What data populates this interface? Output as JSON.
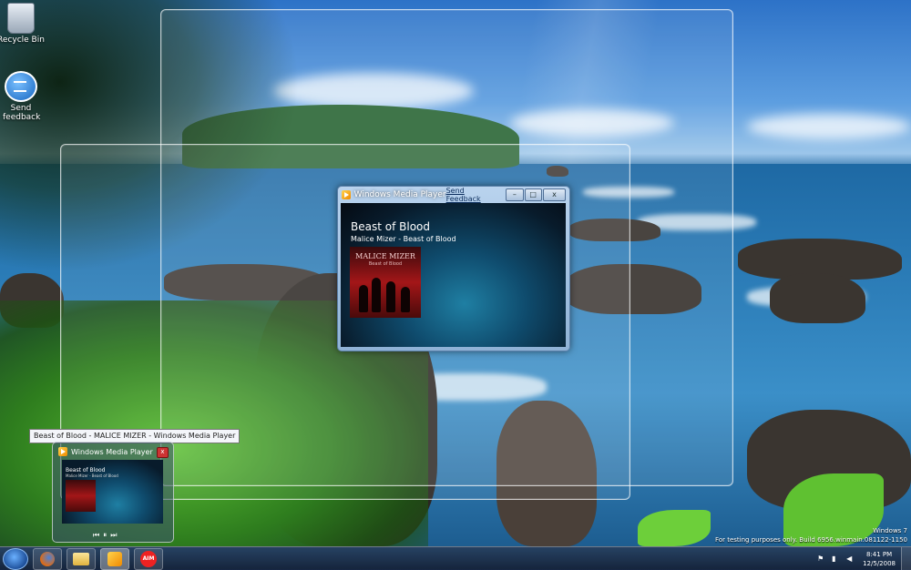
{
  "desktop": {
    "icons": [
      {
        "label": "Recycle Bin",
        "icon": "recycle-bin-icon"
      },
      {
        "label": "Send feedback",
        "icon": "feedback-icon"
      }
    ],
    "watermark": {
      "line1": "Windows 7",
      "line2": "For testing purposes only. Build 6956.winmain.081122-1150"
    }
  },
  "wmp": {
    "title": "Windows Media Player",
    "send_feedback": "Send Feedback",
    "minimize": "–",
    "maximize": "□",
    "close": "x",
    "song": "Beast of Blood",
    "artist_album": "Malice Mizer - Beast of Blood",
    "album_art": {
      "title": "MALICE MIZER",
      "subtitle": "Beast of Blood",
      "colors": {
        "bg": "#a31618",
        "figures": "#0e0303"
      }
    }
  },
  "tooltip": "Beast of Blood - MALICE MIZER - Windows Media Player",
  "thumbnail": {
    "title": "Windows Media Player",
    "close": "x",
    "song": "Beast of Blood",
    "artist_album": "Malice Mizer - Beast of Blood",
    "controls": {
      "prev": "⏮",
      "pause": "⏸",
      "next": "⏭"
    }
  },
  "taskbar": {
    "buttons": [
      {
        "name": "firefox",
        "icon": "firefox-icon"
      },
      {
        "name": "explorer",
        "icon": "folder-icon"
      },
      {
        "name": "wmp",
        "icon": "media-player-icon"
      },
      {
        "name": "aim",
        "icon": "aim-icon",
        "label": "AIM"
      }
    ],
    "clock": {
      "time": "8:41 PM",
      "date": "12/5/2008"
    }
  }
}
